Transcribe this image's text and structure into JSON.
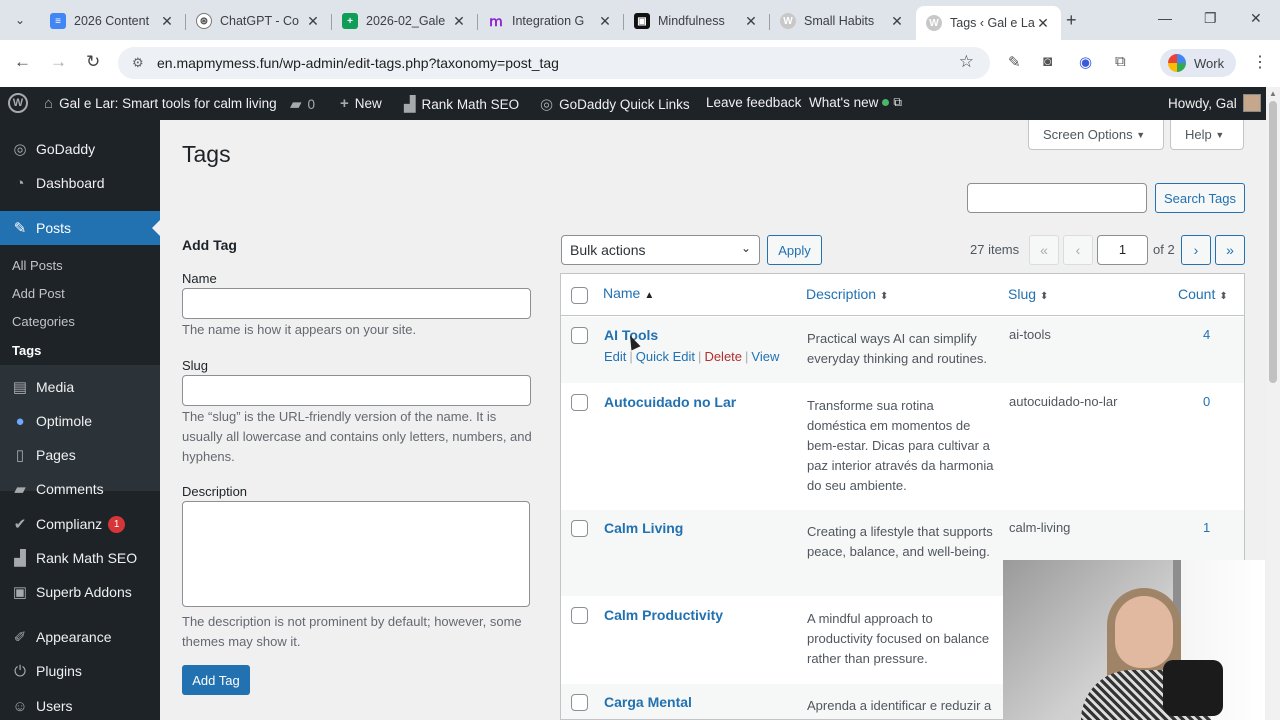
{
  "browser": {
    "tabs": [
      {
        "title": "2026 Content",
        "fav": "docs-icon",
        "color": "#4285f4"
      },
      {
        "title": "ChatGPT - Co",
        "fav": "chatgpt-icon",
        "color": "#555555"
      },
      {
        "title": "2026-02_Gale",
        "fav": "sheets-icon",
        "color": "#0f9d58"
      },
      {
        "title": "Integration G",
        "fav": "make-icon",
        "color": "#8b1fd1"
      },
      {
        "title": "Mindfulness",
        "fav": "notion-icon",
        "color": "#111111"
      },
      {
        "title": "Small Habits",
        "fav": "wp-icon",
        "color": "#b8b8b8"
      },
      {
        "title": "Tags ‹ Gal e La",
        "fav": "wp-icon",
        "color": "#b8b8b8"
      }
    ],
    "url": "en.mapmymess.fun/wp-admin/edit-tags.php?taxonomy=post_tag",
    "profile_label": "Work"
  },
  "adminbar": {
    "site_name": "Gal e Lar: Smart tools for calm living",
    "comments_count": "0",
    "new_label": "New",
    "rankmath_label": "Rank Math SEO",
    "godaddy_label": "GoDaddy Quick Links",
    "feedback_label": "Leave feedback",
    "whatsnew_label": "What's new",
    "howdy": "Howdy, Gal"
  },
  "sidebar": {
    "items": [
      {
        "label": "GoDaddy",
        "icon": "godaddy-icon"
      },
      {
        "label": "Dashboard",
        "icon": "dashboard-icon"
      },
      {
        "label": "Posts",
        "icon": "pin-icon"
      },
      {
        "label": "Media",
        "icon": "media-icon"
      },
      {
        "label": "Optimole",
        "icon": "optimole-icon"
      },
      {
        "label": "Pages",
        "icon": "pages-icon"
      },
      {
        "label": "Comments",
        "icon": "comments-icon"
      },
      {
        "label": "Complianz",
        "icon": "complianz-icon",
        "badge": "1"
      },
      {
        "label": "Rank Math SEO",
        "icon": "rankmath-icon"
      },
      {
        "label": "Superb Addons",
        "icon": "addons-icon"
      },
      {
        "label": "Appearance",
        "icon": "appearance-icon"
      },
      {
        "label": "Plugins",
        "icon": "plugins-icon"
      },
      {
        "label": "Users",
        "icon": "users-icon"
      }
    ],
    "submenu": [
      "All Posts",
      "Add Post",
      "Categories",
      "Tags"
    ]
  },
  "page": {
    "title": "Tags",
    "screen_options": "Screen Options",
    "help": "Help",
    "search_button": "Search Tags"
  },
  "form": {
    "title": "Add Tag",
    "name_label": "Name",
    "name_help": "The name is how it appears on your site.",
    "slug_label": "Slug",
    "slug_help": "The “slug” is the URL-friendly version of the name. It is usually all lowercase and contains only letters, numbers, and hyphens.",
    "desc_label": "Description",
    "desc_help": "The description is not prominent by default; however, some themes may show it.",
    "submit": "Add Tag"
  },
  "list": {
    "bulk_actions": "Bulk actions",
    "apply": "Apply",
    "items_count": "27 items",
    "current_page": "1",
    "of_pages": "of 2",
    "columns": {
      "name": "Name",
      "description": "Description",
      "slug": "Slug",
      "count": "Count"
    },
    "row_actions": {
      "edit": "Edit",
      "quick_edit": "Quick Edit",
      "delete": "Delete",
      "view": "View"
    },
    "rows": [
      {
        "name": "AI Tools",
        "description": "Practical ways AI can simplify everyday thinking and routines.",
        "slug": "ai-tools",
        "count": "4"
      },
      {
        "name": "Autocuidado no Lar",
        "description": "Transforme sua rotina doméstica em momentos de bem-estar. Dicas para cultivar a paz interior através da harmonia do seu ambiente.",
        "slug": "autocuidado-no-lar",
        "count": "0"
      },
      {
        "name": "Calm Living",
        "description": "Creating a lifestyle that supports peace, balance, and well-being.",
        "slug": "calm-living",
        "count": "1"
      },
      {
        "name": "Calm Productivity",
        "description": "A mindful approach to productivity focused on balance rather than pressure.",
        "slug": "",
        "count": ""
      },
      {
        "name": "Carga Mental",
        "description": "Aprenda a identificar e reduzir a carga invisível das tarefas",
        "slug": "",
        "count": ""
      }
    ]
  },
  "colors": {
    "wp_blue": "#2271b1",
    "admin_dark": "#1d2327",
    "delete_red": "#b32d2e"
  }
}
